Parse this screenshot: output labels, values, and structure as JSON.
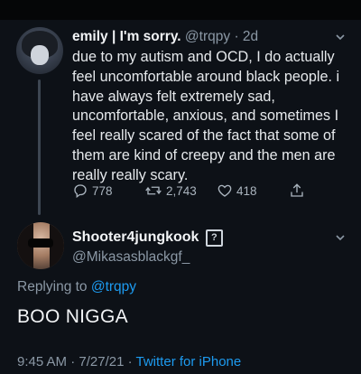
{
  "tweet1": {
    "name": "emily | I'm sorry.",
    "handle": "@trqpy",
    "separator": "·",
    "time": "2d",
    "body": "due to my autism and OCD, I do actually feel uncomfortable around black people. i have always felt extremely sad, uncomfortable, anxious, and sometimes I feel really scared of the fact that some of them are kind of creepy and the men are really really scary.",
    "replies": "778",
    "retweets": "2,743",
    "likes": "418"
  },
  "tweet2": {
    "name": "Shooter4jungkook",
    "badge": "?",
    "handle": "@Mikasasblackgf_",
    "replying_prefix": "Replying to",
    "replying_to": "@trqpy",
    "body": "BOO NIGGA",
    "time": "9:45 AM",
    "date_sep": "·",
    "date": "7/27/21",
    "source_sep": "·",
    "source": "Twitter for iPhone"
  },
  "icons": {
    "reply": "reply-icon",
    "retweet": "retweet-icon",
    "like": "heart-icon",
    "share": "share-icon",
    "more": "chevron-down-icon"
  },
  "colors": {
    "background": "#0d1117",
    "link": "#1d9bf0",
    "secondary_text": "#8b98a5",
    "primary_text": "#e6e9ec"
  }
}
